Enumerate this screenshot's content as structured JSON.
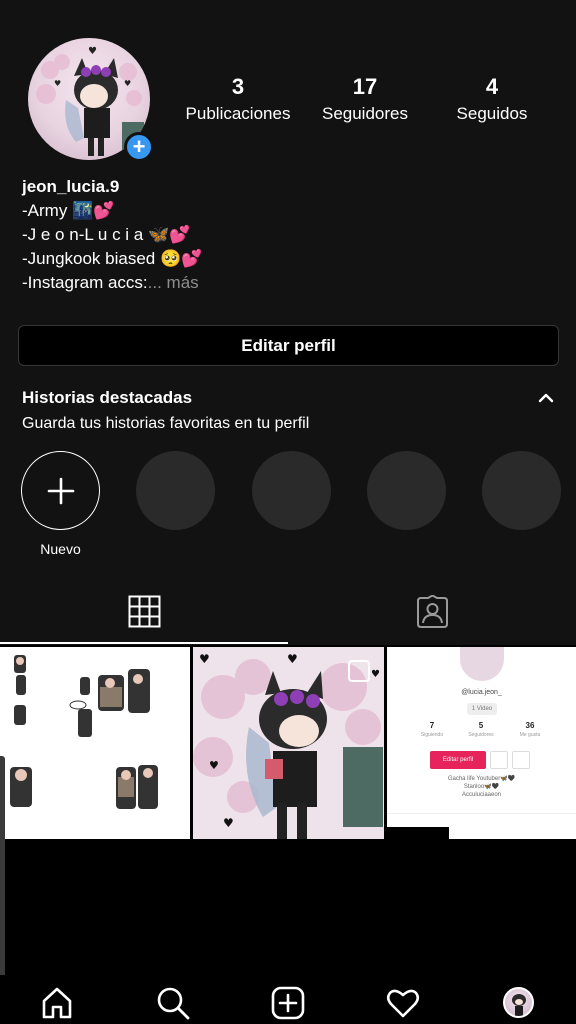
{
  "profile": {
    "username": "jeon_lucia.9",
    "bio_lines": [
      "-Army 🌃💕",
      "-J e o n-L u c i a 🦋💕",
      "-Jungkook biased 🥺💕",
      "-Instagram accs:"
    ],
    "more_label": "... más"
  },
  "stats": [
    {
      "value": "3",
      "label": "Publicaciones"
    },
    {
      "value": "17",
      "label": "Seguidores"
    },
    {
      "value": "4",
      "label": "Seguidos"
    }
  ],
  "edit_profile_label": "Editar perfil",
  "highlights": {
    "title": "Historias destacadas",
    "subtitle": "Guarda tus historias favoritas en tu perfil",
    "new_label": "Nuevo"
  },
  "post3": {
    "username": "@lucia.jeon_",
    "videos_badge": "1 Video",
    "stats": [
      {
        "value": "7",
        "label": "Siguiendo"
      },
      {
        "value": "5",
        "label": "Seguidores"
      },
      {
        "value": "36",
        "label": "Me gusta"
      }
    ],
    "edit_label": "Editar perfil",
    "bio_lines": [
      "Gacha life Youtuber🦋🖤",
      "Stanloo🦋🖤",
      "Acculuciaaeon"
    ]
  },
  "icons": {
    "add_story": "plus-circle-icon",
    "grid_tab": "grid-icon",
    "tagged_tab": "tagged-user-icon",
    "nav": [
      "home-icon",
      "search-icon",
      "create-post-icon",
      "heart-icon",
      "profile-avatar"
    ]
  },
  "colors": {
    "background": "#121212",
    "accent_blue": "#3897f0",
    "tiktok_pink": "#e6235b"
  }
}
